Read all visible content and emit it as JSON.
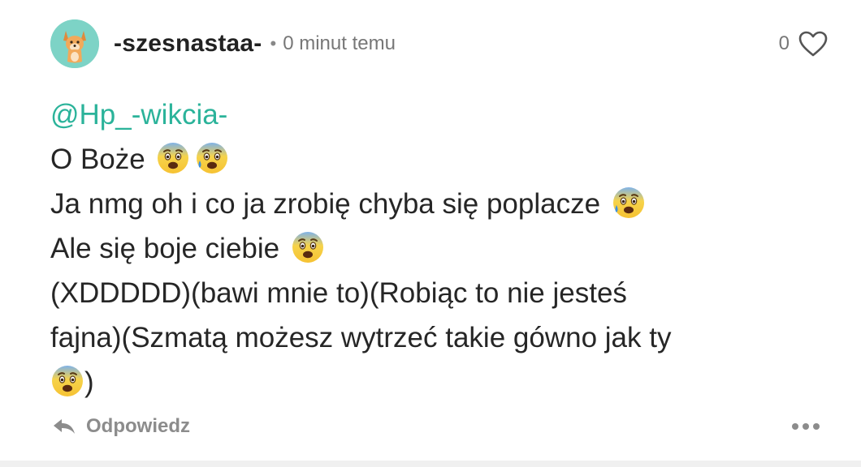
{
  "comment": {
    "author": "-szesnastaa-",
    "separator": "•",
    "timestamp": "0 minut temu",
    "like_count": "0",
    "mention": "@Hp_-wikcia-",
    "lines": {
      "l1": "O Boże",
      "l2": "Ja nmg oh i co ja zrobię chyba się poplacze",
      "l3": "Ale się boje ciebie",
      "l4": "(XDDDDD)(bawi mnie to)(Robiąc to nie jesteś",
      "l5": "fajna)(Szmatą możesz wytrzeć takie gówno jak ty",
      "l6": ")"
    },
    "emojis": {
      "l1": [
        "fearful-face",
        "anxious-face-with-sweat"
      ],
      "l2": [
        "anxious-face-with-sweat"
      ],
      "l3": [
        "fearful-face"
      ],
      "l6": [
        "fearful-face"
      ]
    }
  },
  "actions": {
    "reply_label": "Odpowiedz",
    "reply_icon": "reply-arrow-icon",
    "more_icon": "more-dots-icon",
    "heart_icon": "heart-outline-icon"
  },
  "colors": {
    "mention": "#2bb39a",
    "avatar_bg": "#7dd3c6",
    "text": "#262626",
    "muted": "#8c8c8c"
  }
}
